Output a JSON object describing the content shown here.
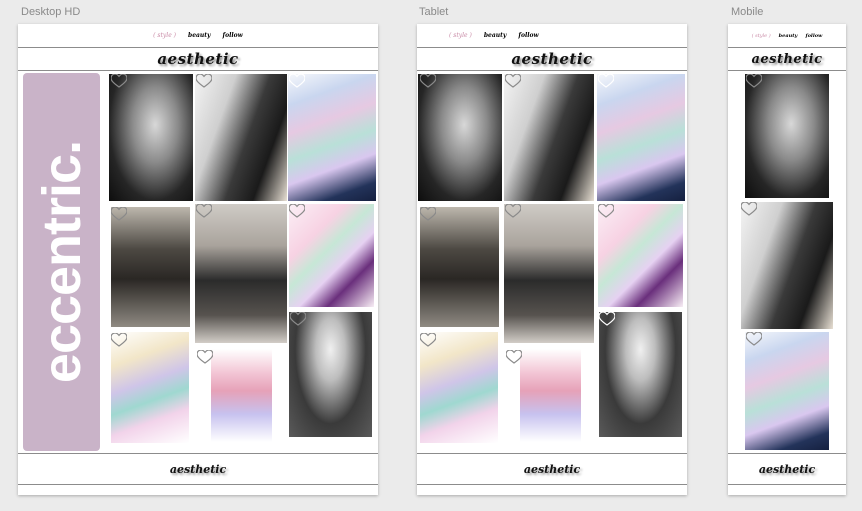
{
  "artboards": {
    "desktop": {
      "label": "Desktop HD"
    },
    "tablet": {
      "label": "Tablet"
    },
    "mobile": {
      "label": "Mobile"
    }
  },
  "nav": {
    "style": "( style )",
    "beauty": "beauty",
    "follow": "follow"
  },
  "brand": "aesthetic",
  "footer_brand": "aesthetic",
  "hero_text": "eccentric.",
  "colors": {
    "hero_panel": "#c9b3c8",
    "nav_style_accent": "#c98aa6",
    "canvas": "#ebebeb"
  },
  "photos": [
    {
      "name": "portrait-hair-bw",
      "icon": "heart-icon"
    },
    {
      "name": "portrait-cigarette-bw",
      "icon": "heart-icon"
    },
    {
      "name": "holographic-hair",
      "icon": "heart-icon"
    },
    {
      "name": "mirror-selfie-bw",
      "icon": "heart-icon"
    },
    {
      "name": "fashion-full-body-bw",
      "icon": "heart-icon"
    },
    {
      "name": "pastel-platform-shoes",
      "icon": "heart-icon"
    },
    {
      "name": "skeleton-makeup-bw",
      "icon": "heart-icon"
    },
    {
      "name": "holographic-backpack",
      "icon": "heart-icon"
    },
    {
      "name": "pink-hair-sunglasses",
      "icon": "heart-icon"
    }
  ]
}
